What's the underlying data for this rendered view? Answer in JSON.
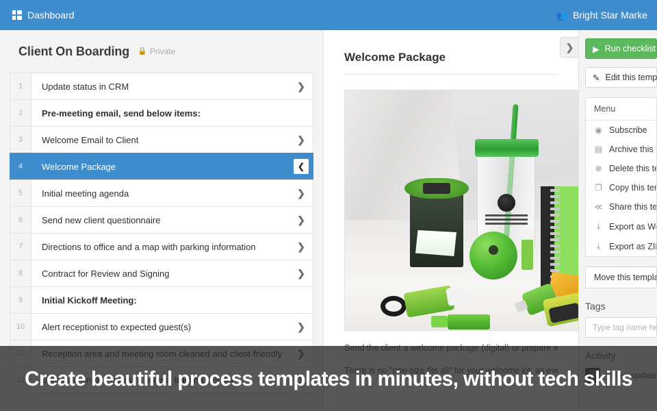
{
  "topbar": {
    "dashboard_label": "Dashboard",
    "grid_icon": "grid-icon",
    "org_name": "Bright Star Marke",
    "people_icon": "people-icon",
    "bg_color": "#3f8dcc"
  },
  "template": {
    "title": "Client On Boarding",
    "privacy_label": "Private",
    "lock_icon": "lock-icon"
  },
  "checklist": [
    {
      "num": "1",
      "label": "Update status in CRM",
      "header": false,
      "selected": false
    },
    {
      "num": "2",
      "label": "Pre-meeting email, send below items:",
      "header": true,
      "selected": false
    },
    {
      "num": "3",
      "label": "Welcome Email to Client",
      "header": false,
      "selected": false
    },
    {
      "num": "4",
      "label": "Welcome Package",
      "header": false,
      "selected": true
    },
    {
      "num": "5",
      "label": "Initial meeting agenda",
      "header": false,
      "selected": false
    },
    {
      "num": "6",
      "label": "Send new client questionnaire",
      "header": false,
      "selected": false
    },
    {
      "num": "7",
      "label": "Directions to office and a map with parking information",
      "header": false,
      "selected": false
    },
    {
      "num": "8",
      "label": "Contract for Review and Signing",
      "header": false,
      "selected": false
    },
    {
      "num": "9",
      "label": "Initial Kickoff Meeting:",
      "header": true,
      "selected": false
    },
    {
      "num": "10",
      "label": "Alert receptionist to expected guest(s)",
      "header": false,
      "selected": false
    },
    {
      "num": "11",
      "label": "Reception area and meeting room cleaned and client-friendly",
      "header": false,
      "selected": false
    },
    {
      "num": "12",
      "label": "Schedule on-line account access training session",
      "header": false,
      "selected": false
    }
  ],
  "task": {
    "title": "Welcome Package",
    "paragraph_1": "Send the client a welcome package (digital) or prepare welcom",
    "paragraph_2": "There is no \"one-size fits all\" for your welcome kit, as every bu",
    "expand_icon": "chevron-right-icon",
    "collapse_icon": "chevron-left-icon",
    "image_alt": "Green branded promotional welcome kit items"
  },
  "sidebar": {
    "run_label": "Run checklist",
    "run_icon": "play-icon",
    "run_color": "#5cb85c",
    "edit_label": "Edit this temp",
    "edit_icon": "pencil-icon",
    "menu_title": "Menu",
    "menu_items": [
      {
        "label": "Subscribe",
        "icon": "eye-icon"
      },
      {
        "label": "Archive this te",
        "icon": "archive-icon"
      },
      {
        "label": "Delete this ter",
        "icon": "delete-circle-icon"
      },
      {
        "label": "Copy this tem",
        "icon": "copy-icon"
      },
      {
        "label": "Share this ten",
        "icon": "share-icon"
      },
      {
        "label": "Export as Wo",
        "icon": "download-icon"
      },
      {
        "label": "Export as ZIP",
        "icon": "download-icon"
      }
    ],
    "move_label": "Move this templa",
    "tags_label": "Tags",
    "tag_placeholder": "Type tag name he",
    "activity_label": "Activity",
    "activity_user": "Vinay",
    "activity_text": " update"
  },
  "overlay": {
    "caption": "Create beautiful process templates in minutes, without tech skills",
    "bg_color": "#282828"
  }
}
